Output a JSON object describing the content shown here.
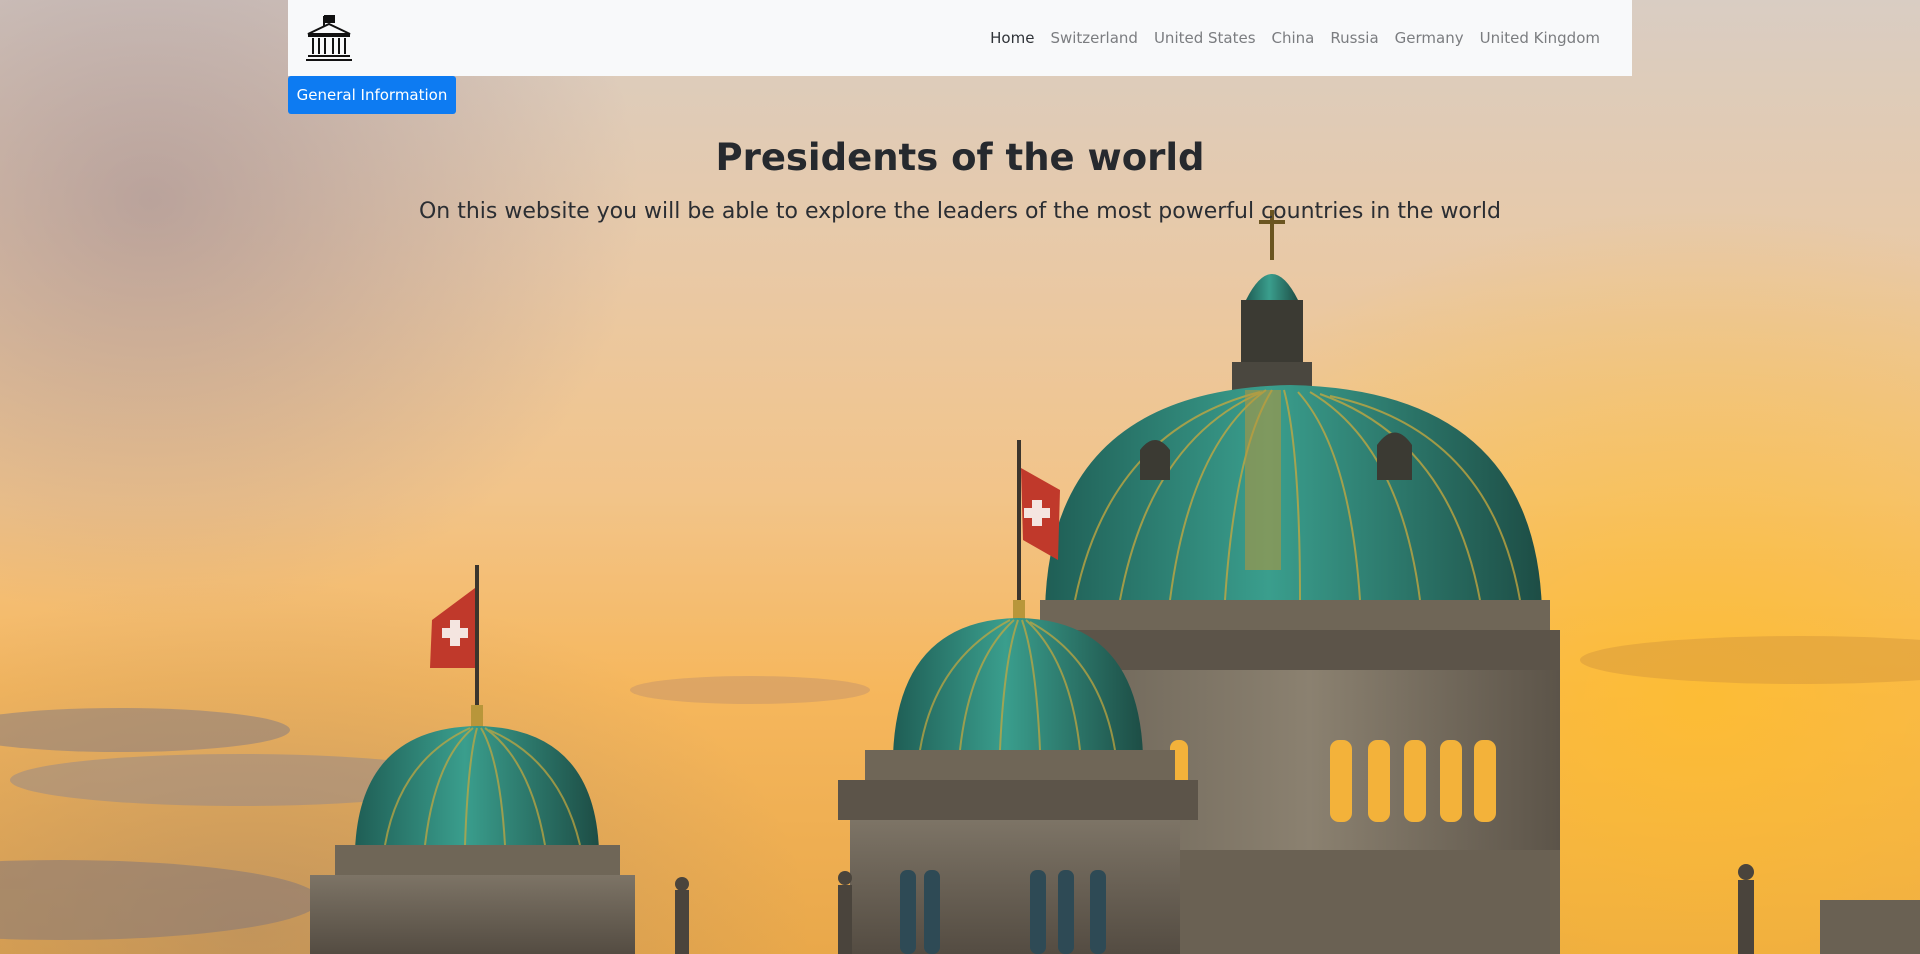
{
  "navbar": {
    "logo_icon": "government-building-icon",
    "links": [
      {
        "label": "Home",
        "active": true
      },
      {
        "label": "Switzerland",
        "active": false
      },
      {
        "label": "United States",
        "active": false
      },
      {
        "label": "China",
        "active": false
      },
      {
        "label": "Russia",
        "active": false
      },
      {
        "label": "Germany",
        "active": false
      },
      {
        "label": "United Kingdom",
        "active": false
      }
    ]
  },
  "general_info_button": {
    "label": "General Information",
    "color": "#0d7bf2"
  },
  "hero": {
    "title": "Presidents of the world",
    "subtitle": "On this website you will be able to explore the leaders of the most powerful countries in the world"
  },
  "background": {
    "icon": "federal-palace-dome-image",
    "sky_colors": [
      "#d9cdc3",
      "#f2c489",
      "#f6b75d"
    ],
    "dome_color": "#2f8a7c"
  }
}
